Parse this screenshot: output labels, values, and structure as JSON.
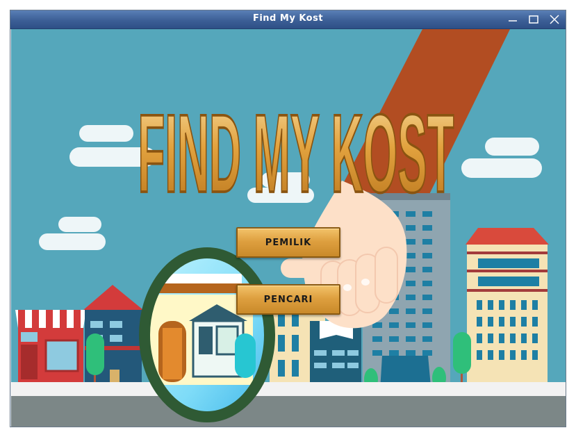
{
  "window": {
    "title": "Find My Kost",
    "controls": [
      "minimize-icon",
      "maximize-icon",
      "close-icon"
    ]
  },
  "hero": {
    "logo_text": "FIND MY KOST"
  },
  "menu": {
    "owner_label": "PEMILIK",
    "seeker_label": "PENCARI"
  },
  "colors": {
    "sky": "#55a7bb",
    "titlebar": "#3c5f96",
    "button": "#dea040",
    "logo_gold": "#e5a03a",
    "magnifier_ring": "#2f5a34"
  }
}
